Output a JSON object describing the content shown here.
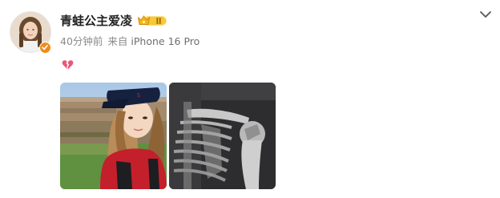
{
  "post": {
    "author_name": "青蛙公主爱凌",
    "badge_level": "Ⅱ",
    "time_ago": "40分钟前",
    "source_prefix": "来自",
    "device": "iPhone 16 Pro",
    "content_emoji": "broken-heart",
    "images": [
      {
        "alt": "selfie-photo"
      },
      {
        "alt": "shoulder-xray"
      }
    ]
  },
  "colors": {
    "name": "#222222",
    "meta": "#8a8a8a",
    "verified": "#f08c1a",
    "badge": "#f6b618",
    "heart": "#e8577a"
  },
  "icons": [
    "avatar",
    "verified-icon",
    "member-badge-icon",
    "chevron-down-icon",
    "broken-heart-icon"
  ]
}
